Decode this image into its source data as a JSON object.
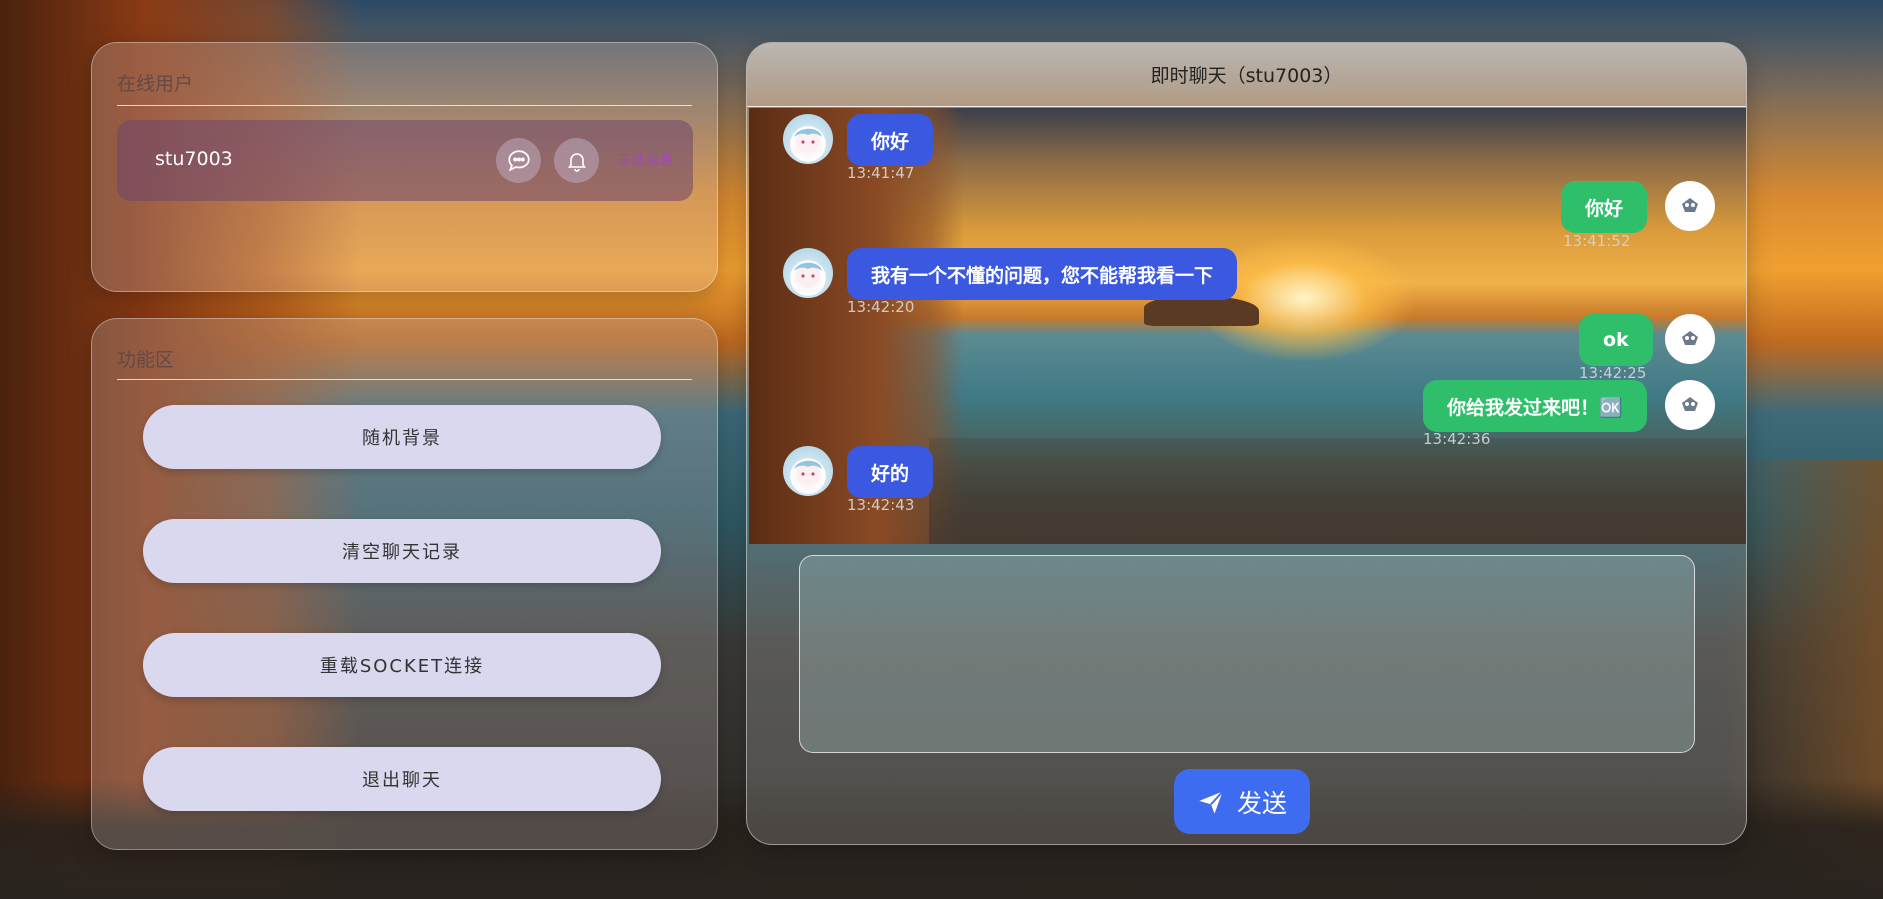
{
  "online_users": {
    "title": "在线用户",
    "users": [
      {
        "name": "stu7003",
        "status": "未读消息"
      }
    ]
  },
  "functions": {
    "title": "功能区",
    "buttons": [
      "随机背景",
      "清空聊天记录",
      "重载SOCKET连接",
      "退出聊天"
    ]
  },
  "chat": {
    "title": "即时聊天（stu7003）",
    "messages": [
      {
        "side": "left",
        "text": "你好",
        "time": "13:41:47"
      },
      {
        "side": "right",
        "text": "你好",
        "time": "13:41:52"
      },
      {
        "side": "left",
        "text": "我有一个不懂的问题，您不能帮我看一下",
        "time": "13:42:20"
      },
      {
        "side": "right",
        "text": "ok",
        "time": "13:42:25"
      },
      {
        "side": "right",
        "text": "你给我发过来吧！🆗",
        "time": "13:42:36"
      },
      {
        "side": "left",
        "text": "好的",
        "time": "13:42:43"
      }
    ],
    "send_label": "发送",
    "input_value": ""
  },
  "icons": {
    "chat": "chat-bubble-icon",
    "bell": "bell-icon",
    "send": "paper-plane-icon"
  },
  "colors": {
    "bubble_left": "#3a58e0",
    "bubble_right": "#2fbf6a",
    "send_button": "#3d6cf0",
    "function_button": "#d9d8ee"
  }
}
